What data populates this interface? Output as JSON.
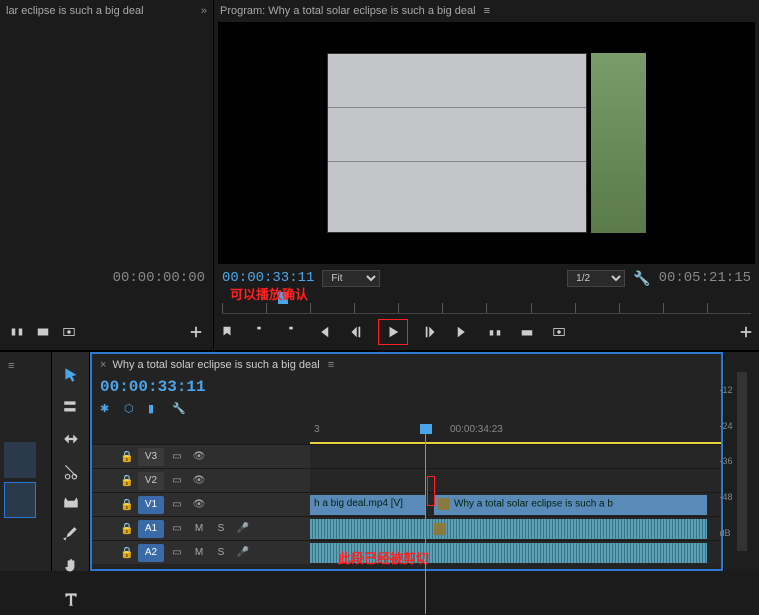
{
  "source": {
    "tab_title": "lar eclipse is such a big deal",
    "timecode": "00:00:00:00"
  },
  "program": {
    "tab_title": "Program: Why a total solar eclipse is such a big deal",
    "timecode_left": "00:00:33:11",
    "fit_label": "Fit",
    "zoom_label": "1/2",
    "timecode_right": "00:05:21:15"
  },
  "annotations": {
    "play_confirm": "可以播放确认",
    "already_cut": "此段已经被剪切"
  },
  "timeline": {
    "tab_title": "Why a total solar eclipse is such a big deal",
    "timecode": "00:00:33:11",
    "ruler": {
      "label1": "3",
      "label2": "00:00:34:23"
    },
    "tracks": {
      "v3": "V3",
      "v2": "V2",
      "v1": "V1",
      "a1": "A1",
      "a2": "A2",
      "m_label": "M",
      "s_label": "S"
    },
    "clip1": "h a big deal.mp4 [V]",
    "clip2": "Why a total solar eclipse is such a b"
  },
  "meter": {
    "l1": "-12",
    "l2": "-24",
    "l3": "-36",
    "l4": "-48",
    "l5": "dB"
  }
}
